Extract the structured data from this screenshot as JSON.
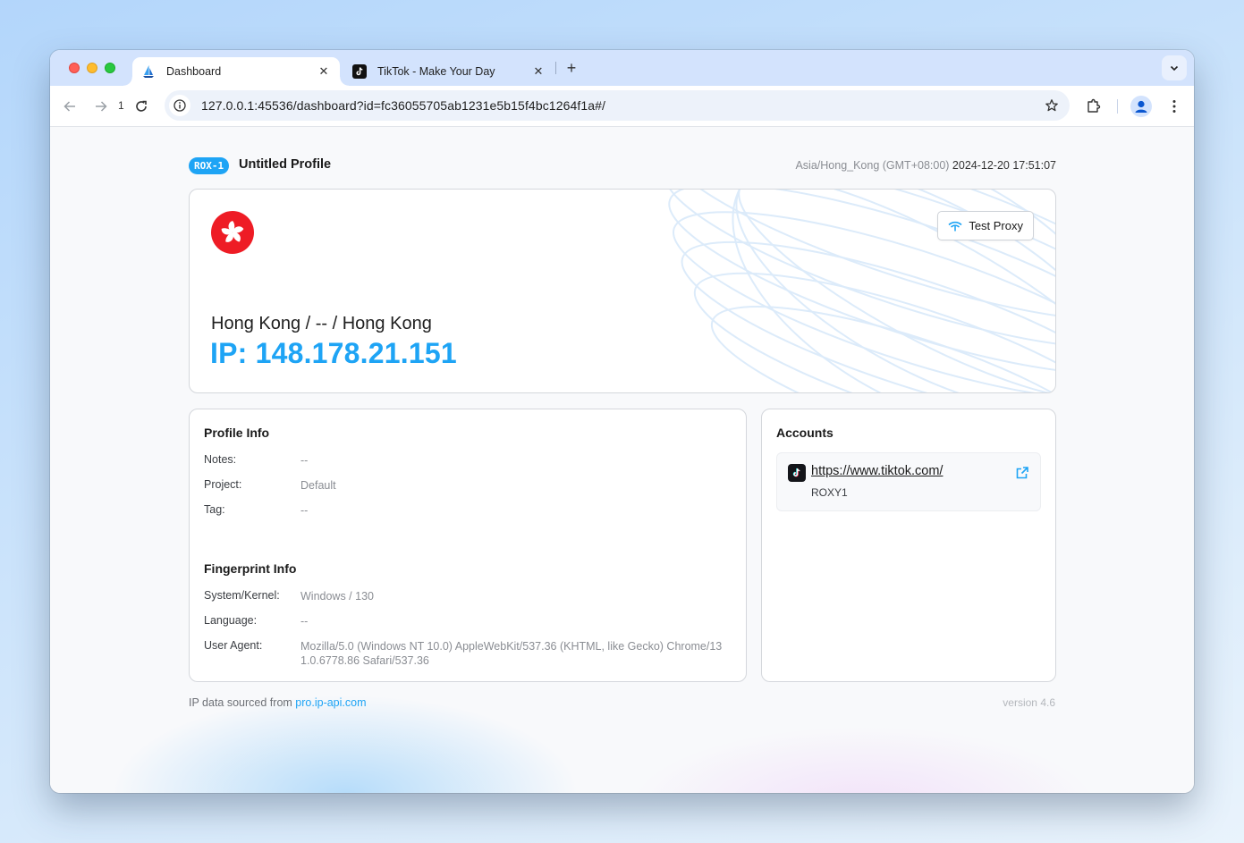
{
  "browser": {
    "tabs": [
      {
        "title": "Dashboard",
        "favicon": "sailboat-icon",
        "active": true
      },
      {
        "title": "TikTok - Make Your Day",
        "favicon": "tiktok-icon",
        "active": false
      }
    ],
    "nav_count": "1",
    "url": "127.0.0.1:45536/dashboard?id=fc36055705ab1231e5b15f4bc1264f1a#/"
  },
  "header": {
    "badge": "ROX-1",
    "profile_name": "Untitled Profile",
    "timezone": "Asia/Hong_Kong (GMT+08:00)",
    "datetime": "2024-12-20 17:51:07"
  },
  "hero": {
    "flag": "hong-kong-flag",
    "test_proxy_label": "Test Proxy",
    "location": "Hong Kong / -- / Hong Kong",
    "ip": "IP: 148.178.21.151",
    "colors": {
      "accent": "#1ea4f5",
      "flag_red": "#ee1c25"
    }
  },
  "profile_info": {
    "title": "Profile Info",
    "rows": [
      {
        "label": "Notes:",
        "value": "--"
      },
      {
        "label": "Project:",
        "value": "Default"
      },
      {
        "label": "Tag:",
        "value": "--"
      }
    ]
  },
  "fingerprint_info": {
    "title": "Fingerprint Info",
    "rows": [
      {
        "label": "System/Kernel:",
        "value": "Windows / 130"
      },
      {
        "label": "Language:",
        "value": "--"
      },
      {
        "label": "User Agent:",
        "value": "Mozilla/5.0 (Windows NT 10.0) AppleWebKit/537.36 (KHTML, like Gecko) Chrome/131.0.6778.86 Safari/537.36"
      }
    ]
  },
  "accounts": {
    "title": "Accounts",
    "items": [
      {
        "url": "https://www.tiktok.com/",
        "name": "ROXY1",
        "icon": "tiktok-icon"
      }
    ]
  },
  "footer": {
    "source_prefix": "IP data sourced from",
    "source_link": "pro.ip-api.com",
    "version": "version 4.6"
  }
}
